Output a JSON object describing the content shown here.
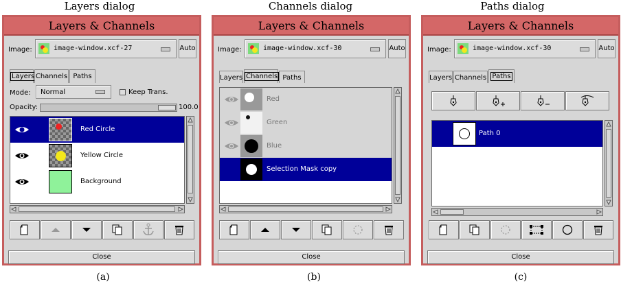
{
  "captions": {
    "top": [
      "Layers dialog",
      "Channels dialog",
      "Paths dialog"
    ],
    "bottom": [
      "(a)",
      "(b)",
      "(c)"
    ]
  },
  "window_title": "Layers & Channels",
  "image_label": "Image:",
  "auto_label": "Auto",
  "close_label": "Close",
  "tabs": [
    "Layers",
    "Channels",
    "Paths"
  ],
  "layers": {
    "image_name": "image-window.xcf-27",
    "mode_label": "Mode:",
    "mode_value": "Normal",
    "keep_trans_label": "Keep Trans.",
    "opacity_label": "Opacity:",
    "opacity_value": "100.0",
    "opacity_fraction": 1.0,
    "items": [
      {
        "name": "Red Circle",
        "selected": true
      },
      {
        "name": "Yellow Circle",
        "selected": false
      },
      {
        "name": "Background",
        "selected": false
      }
    ],
    "buttons": [
      "new-layer-icon",
      "raise-layer-icon",
      "lower-layer-icon",
      "duplicate-layer-icon",
      "anchor-icon",
      "delete-icon"
    ]
  },
  "channels": {
    "image_name": "image-window.xcf-30",
    "items": [
      {
        "name": "Red",
        "selected": false,
        "inactive": true
      },
      {
        "name": "Green",
        "selected": false,
        "inactive": true
      },
      {
        "name": "Blue",
        "selected": false,
        "inactive": true
      },
      {
        "name": "Selection Mask copy",
        "selected": true,
        "inactive": false
      }
    ],
    "buttons": [
      "new-channel-icon",
      "raise-channel-icon",
      "lower-channel-icon",
      "duplicate-channel-icon",
      "channel-to-selection-icon",
      "delete-icon"
    ]
  },
  "paths": {
    "image_name": "image-window.xcf-30",
    "tool_buttons": [
      "new-point-pen-icon",
      "add-point-pen-icon",
      "delete-point-pen-icon",
      "edit-point-pen-icon"
    ],
    "items": [
      {
        "name": "Path 0",
        "selected": true
      }
    ],
    "buttons": [
      "new-path-icon",
      "duplicate-path-icon",
      "path-to-selection-icon",
      "stroke-path-icon",
      "circle-icon",
      "delete-icon"
    ]
  }
}
